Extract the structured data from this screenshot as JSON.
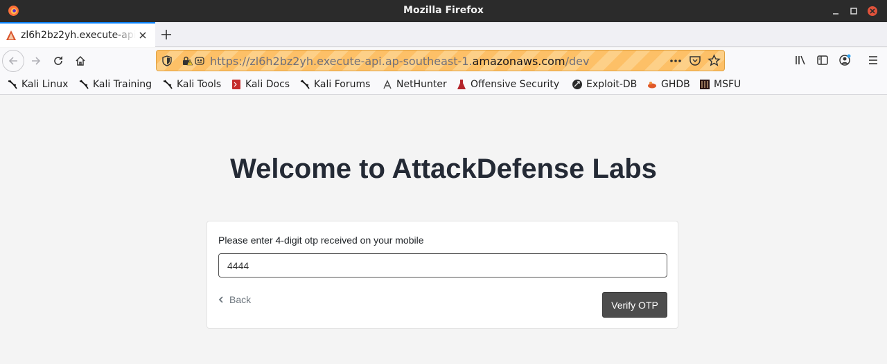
{
  "window": {
    "title": "Mozilla Firefox"
  },
  "tab": {
    "title": "zl6h2bz2yh.execute-api.ap-southeast-1.amazonaws.com"
  },
  "urlbar": {
    "prefix": "https://zl6h2bz2yh.execute-api.ap-southeast-1.",
    "domain": "amazonaws.com",
    "path": "/dev"
  },
  "bookmarks": [
    {
      "label": "Kali Linux",
      "icon": "kali-dragon-icon"
    },
    {
      "label": "Kali Training",
      "icon": "kali-dragon-icon"
    },
    {
      "label": "Kali Tools",
      "icon": "kali-dragon-icon"
    },
    {
      "label": "Kali Docs",
      "icon": "kali-docs-icon"
    },
    {
      "label": "Kali Forums",
      "icon": "kali-dragon-icon"
    },
    {
      "label": "NetHunter",
      "icon": "nethunter-icon"
    },
    {
      "label": "Offensive Security",
      "icon": "offsec-icon"
    },
    {
      "label": "Exploit-DB",
      "icon": "exploit-db-icon"
    },
    {
      "label": "GHDB",
      "icon": "ghdb-icon"
    },
    {
      "label": "MSFU",
      "icon": "msfu-icon"
    }
  ],
  "page": {
    "heading": "Welcome to AttackDefense Labs",
    "otp_label": "Please enter 4-digit otp received on your mobile",
    "otp_value": "4444",
    "back_label": "Back",
    "verify_label": "Verify OTP"
  },
  "colors": {
    "titlebar": "#2b2b2b",
    "accent": "#0a84ff",
    "urlbar_warning": "#fdc067",
    "heading": "#242a35",
    "verify_button": "#4d4d4d"
  }
}
